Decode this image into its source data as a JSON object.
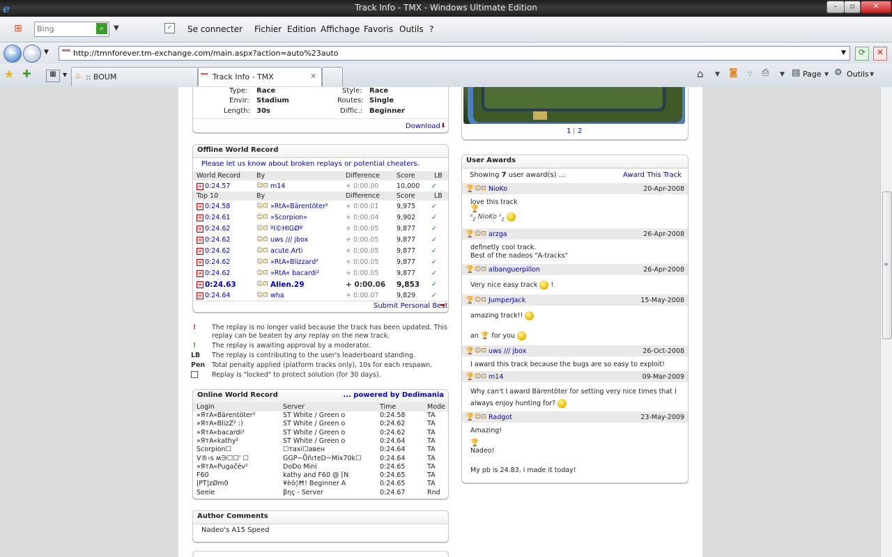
{
  "window": {
    "title": "Track Info - TMX - Windows Ultimate Edition"
  },
  "menubar": {
    "search_placeholder": "Bing",
    "connect": "Se connecter",
    "items": [
      "Fichier",
      "Edition",
      "Affichage",
      "Favoris",
      "Outils",
      "?"
    ]
  },
  "address": {
    "url": "http://tmnforever.tm-exchange.com/main.aspx?action=auto%23auto"
  },
  "tabs": [
    {
      "label": ":: BOUM"
    },
    {
      "label": "Track Info - TMX"
    }
  ],
  "toolbar": {
    "page": "Page",
    "tools": "Outils"
  },
  "track_info": {
    "type_label": "Type:",
    "type_value": "Race",
    "style_label": "Style:",
    "style_value": "Race",
    "envir_label": "Envir:",
    "envir_value": "Stadium",
    "routes_label": "Routes:",
    "routes_value": "Single",
    "length_label": "Length:",
    "length_value": "30s",
    "diffic_label": "Diffic.:",
    "diffic_value": "Beginner",
    "download": "Download"
  },
  "screenshot_pager": {
    "p1": "1",
    "sep": "|",
    "p2": "2"
  },
  "offline_wr": {
    "title": "Offline World Record",
    "notice": "Please let us know about broken replays or potential cheaters.",
    "headers": {
      "wr": "World Record",
      "by": "By",
      "diff": "Difference",
      "score": "Score",
      "lb": "LB"
    },
    "world_record": {
      "time": "0:24.57",
      "by": "m14",
      "diff": "+ 0:00.00",
      "score": "10,000",
      "lb": "✓"
    },
    "top_headers": {
      "top": "Top 10",
      "by": "By",
      "diff": "Difference",
      "score": "Score",
      "lb": "LB"
    },
    "rows": [
      {
        "time": "0:24.58",
        "by": "»RtA«Bärentöter²",
        "diff": "+ 0:00.01",
        "score": "9,975",
        "lb": "✓"
      },
      {
        "time": "0:24.61",
        "by": "»Scorpion«",
        "diff": "+ 0:00.04",
        "score": "9,902",
        "lb": "✓"
      },
      {
        "time": "0:24.62",
        "by": "ºI©HIGØº",
        "diff": "+ 0:00.05",
        "score": "9,877",
        "lb": "✓"
      },
      {
        "time": "0:24.62",
        "by": "uws /// jbox",
        "diff": "+ 0:00.05",
        "score": "9,877",
        "lb": "✓"
      },
      {
        "time": "0:24.62",
        "by": "acute.Arti",
        "diff": "+ 0:00.05",
        "score": "9,877",
        "lb": "✓"
      },
      {
        "time": "0:24.62",
        "by": "»RtA«Blizzard²",
        "diff": "+ 0:00.05",
        "score": "9,877",
        "lb": "✓"
      },
      {
        "time": "0:24.62",
        "by": "»RtA« bacardi²",
        "diff": "+ 0:00.05",
        "score": "9,877",
        "lb": "✓"
      },
      {
        "time": "0:24.63",
        "by": "Alien.29",
        "diff": "+ 0:00.06",
        "score": "9,853",
        "lb": "✓",
        "bold": true
      },
      {
        "time": "0:24.64",
        "by": "wha",
        "diff": "+ 0:00.07",
        "score": "9,829",
        "lb": "✓"
      }
    ],
    "submit": "Submit Personal Best"
  },
  "legend": {
    "l1a": "The replay is no longer valid because the track has been updated. This",
    "l1b_pre": "replay can be beaten by ",
    "l1b_em": "any",
    "l1b_post": " replay on the new track.",
    "l2": "The replay is awaiting approval by a moderator.",
    "lb_key": "LB",
    "lb": "The replay is contributing to the user's leaderboard standing.",
    "pen_key": "Pen",
    "pen": "Total penalty applied (platform tracks only), 10s for each respawn.",
    "lock": "Replay is \"locked\" to protect solution (for 30 days)."
  },
  "online_wr": {
    "title": "Online World Record",
    "powered": "... powered by Dedimania",
    "headers": {
      "login": "Login",
      "server": "Server",
      "time": "Time",
      "mode": "Mode"
    },
    "rows": [
      {
        "login": "»ЯтA«Bärentöter²",
        "server": "ST White / Green o",
        "time": "0:24.58",
        "mode": "TA"
      },
      {
        "login": "»ЯтA«BlizZ² :)",
        "server": "ST White / Green o",
        "time": "0:24.62",
        "mode": "TA"
      },
      {
        "login": "»ЯтA«bacardi²",
        "server": "ST White / Green o",
        "time": "0:24.62",
        "mode": "TA"
      },
      {
        "login": "»ЯтA«kathy²",
        "server": "ST White / Green o",
        "time": "0:24.64",
        "mode": "TA"
      },
      {
        "login": "Scorpion☐",
        "server": "☐тaxi☐aвен",
        "time": "0:24.64",
        "mode": "TA"
      },
      {
        "login": "V®›s ʍ∋☐☐' ☐",
        "server": "GGP~Ůñı†eD~Mix70k☐",
        "time": "0:24.64",
        "mode": "TA"
      },
      {
        "login": "»ЯтA«Pugačëv²",
        "server": "DoDo Mini",
        "time": "0:24.65",
        "mode": "TA"
      },
      {
        "login": "F60",
        "server": "kathy and F60 @ [N",
        "time": "0:24.65",
        "mode": "TA"
      },
      {
        "login": "|PT|zØm߀",
        "server": "¥èö◊Ħ! Beginner A",
        "time": "0:24.65",
        "mode": "TA"
      },
      {
        "login": "Seele",
        "server": "βηç - Server",
        "time": "0:24.67",
        "mode": "Rnd"
      }
    ]
  },
  "author_comments": {
    "title": "Author Comments",
    "text": "Nadeo's A15 Speed"
  },
  "user_awards": {
    "title": "User Awards",
    "showing_pre": "Showing ",
    "count": "7",
    "showing_post": " user award(s) ...",
    "award_link": "Award This Track",
    "awards": [
      {
        "user": "NioKo",
        "date": "20-Apr-2008",
        "lines": [
          "love this track"
        ],
        "sig": "NioKo"
      },
      {
        "user": "arzga",
        "date": "26-Apr-2008",
        "lines": [
          "definetly cool track.",
          "Best of the nadeos \"A-tracks\""
        ]
      },
      {
        "user": "albanguerpillon",
        "date": "26-Apr-2008",
        "lines": [
          "Very nice easy track",
          "!"
        ]
      },
      {
        "user": "JumperJack",
        "date": "15-May-2008",
        "lines": [
          "amazing track!!",
          "an",
          "for you"
        ]
      },
      {
        "user": "uws /// jbox",
        "date": "26-Oct-2008",
        "lines": [
          "I award this track because the bugs are so easy to exploit!"
        ]
      },
      {
        "user": "m14",
        "date": "09-Mar-2009",
        "lines": [
          "Why can't I award Bärentöter for setting very nice times that I",
          "always enjoy hunting for?"
        ]
      },
      {
        "user": "Radgot",
        "date": "23-May-2009",
        "lines": [
          "Amazing!",
          "Nadeo!",
          "My pb is 24.83, i made it today!"
        ]
      }
    ]
  }
}
